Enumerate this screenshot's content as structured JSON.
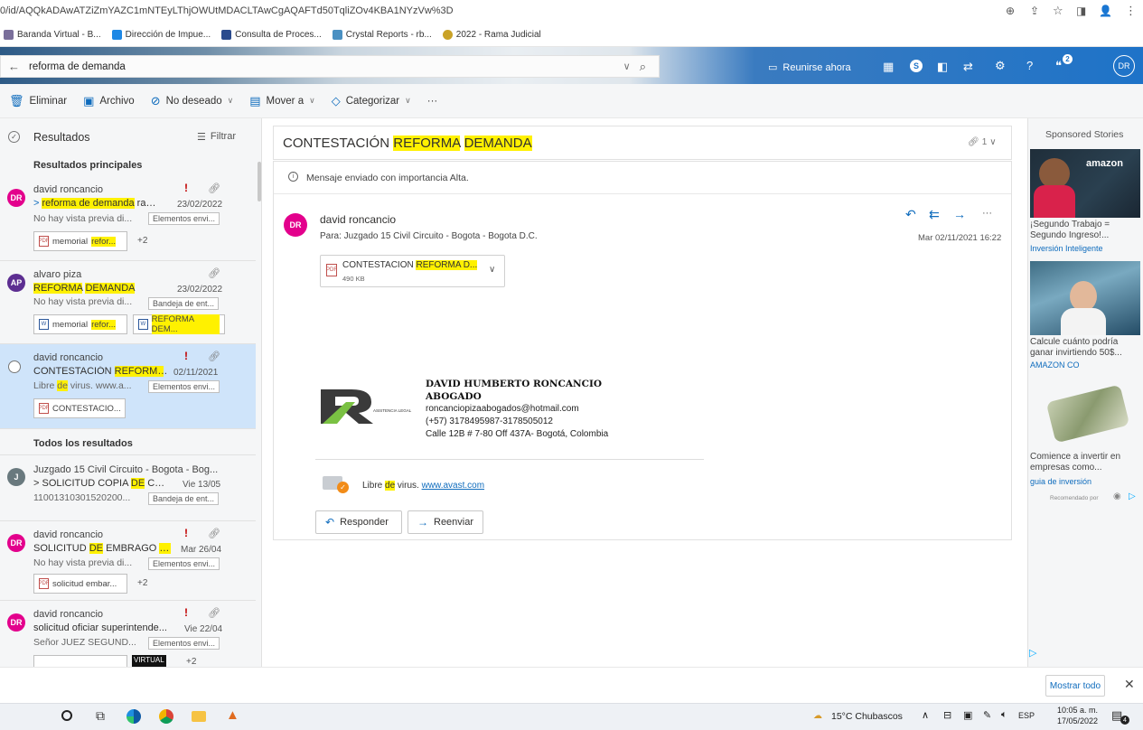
{
  "browser": {
    "url": "0/id/AQQkADAwATZiZmYAZC1mNTEyLThjOWUtMDACLTAwCgAQAFTd50TqliZOv4KBA1NYzVw%3D",
    "bookmarks": [
      "Baranda Virtual - B...",
      "Dirección de Impue...",
      "Consulta de Proces...",
      "Crystal Reports - rb...",
      "2022 - Rama Judicial"
    ]
  },
  "header": {
    "search_value": "reforma de demanda",
    "meet_now_label": "Reunirse ahora",
    "help_label": "?",
    "notification_count": "2",
    "user_initials": "DR"
  },
  "commands": {
    "delete": "Eliminar",
    "archive": "Archivo",
    "junk": "No deseado",
    "move": "Mover a",
    "categorize": "Categorizar",
    "more": "···"
  },
  "list": {
    "title": "Resultados",
    "filter": "Filtrar",
    "top_results": "Resultados principales",
    "all_results": "Todos los resultados",
    "msg1": {
      "initials": "DR",
      "sender": "david roncancio",
      "subj_pre": "> ",
      "subj_hl": "reforma de demanda",
      "subj_post": " rad ...",
      "date": "23/02/2022",
      "preview": "No hay vista previa di...",
      "folder": "Elementos envi...",
      "chip_pre": "memorial ",
      "chip_hl": "refor...",
      "extra": "+2"
    },
    "msg2": {
      "initials": "AP",
      "sender": "alvaro piza",
      "subj_hl1": "REFORMA",
      "subj_mid": " ",
      "subj_hl2": "DEMANDA",
      "date": "23/02/2022",
      "preview": "No hay vista previa di...",
      "folder": "Bandeja de ent...",
      "chip1_pre": "memorial ",
      "chip1_hl": "refor...",
      "chip2_hl": "REFORMA DEM..."
    },
    "msg3": {
      "initials": "",
      "sender": "david roncancio",
      "subj_pre": "CONTESTACIÓN ",
      "subj_hl": "REFORMA",
      "subj_post": " ...",
      "date": "02/11/2021",
      "preview_pre": "Libre ",
      "preview_hl": "de",
      "preview_post": " virus. www.a...",
      "folder": "Elementos envi...",
      "chip": "CONTESTACIO..."
    },
    "msg4": {
      "initials": "J",
      "sender": "Juzgado 15 Civil Circuito - Bogota - Bog...",
      "subj_pre": "> SOLICITUD COPIA ",
      "subj_hl": "DE",
      "subj_post": " CARP...",
      "date": "Vie 13/05",
      "preview": "11001310301520200...",
      "folder": "Bandeja de ent..."
    },
    "msg5": {
      "initials": "DR",
      "sender": "david roncancio",
      "subj_pre": "SOLICITUD ",
      "subj_hl": "DE",
      "subj_mid": " EMBRAGO ",
      "subj_hl2": "DE",
      "subj_post": "...",
      "date": "Mar 26/04",
      "preview": "No hay vista previa di...",
      "folder": "Elementos envi...",
      "chip": "solicitud embar...",
      "extra": "+2"
    },
    "msg6": {
      "initials": "DR",
      "sender": "david roncancio",
      "subject": "solicitud oficiar superintende...",
      "date": "Vie 22/04",
      "preview": "Señor JUEZ SEGUND...",
      "folder": "Elementos envi...",
      "chip_hl": "VIRTUAL",
      "extra": "+2"
    }
  },
  "reading": {
    "subject_pre": "CONTESTACIÓN ",
    "subject_hl1": "REFORMA",
    "subject_hl2": "DEMANDA",
    "attachment_count": "1",
    "importance": "Mensaje enviado con importancia Alta.",
    "sender_initials": "DR",
    "sender": "david roncancio",
    "to": "Para: Juzgado 15 Civil Circuito - Bogota - Bogota D.C.",
    "datetime": "Mar 02/11/2021 16:22",
    "file_pre": "CONTESTACION ",
    "file_hl": "REFORMA D...",
    "file_size": "490 KB",
    "sig_name": "DAVID HUMBERTO RONCANCIO",
    "sig_title": "ABOGADO",
    "sig_email": "roncanciopizaabogados@hotmail.com",
    "sig_phone": "(+57) 3178495987-3178505012",
    "sig_address": "Calle 12B # 7-80 Off 437A- Bogotá, Colombia",
    "logo_text": "ASISTENCIA LEGAL",
    "avast_pre": "Libre ",
    "avast_hl": "de",
    "avast_post": " virus.",
    "avast_link": "www.avast.com",
    "reply": "Responder",
    "forward": "Reenviar"
  },
  "ads": {
    "title": "Sponsored Stories",
    "ad1_brand": "amazon",
    "ad1_text": "¡Segundo Trabajo = Segundo Ingreso!...",
    "ad1_source": "Inversión Inteligente",
    "ad2_text": "Calcule cuánto podría ganar invirtiendo 50$...",
    "ad2_source": "AMAZON CO",
    "ad3_text": "Comience a invertir en empresas como...",
    "ad3_source": "guia de inversión",
    "recommended": "Recomendado por"
  },
  "downloads": {
    "show_all": "Mostrar todo"
  },
  "taskbar": {
    "weather": "15°C Chubascos",
    "lang": "ESP",
    "time": "10:05 a. m.",
    "date": "17/05/2022",
    "notif": "4"
  },
  "colors": {
    "accent": "#0f6cbd",
    "highlight": "#fff100",
    "selected_row": "#cfe4fa",
    "avatar_pink": "#e3008c",
    "avatar_purple": "#5c2e91",
    "avatar_gray": "#69797e"
  }
}
